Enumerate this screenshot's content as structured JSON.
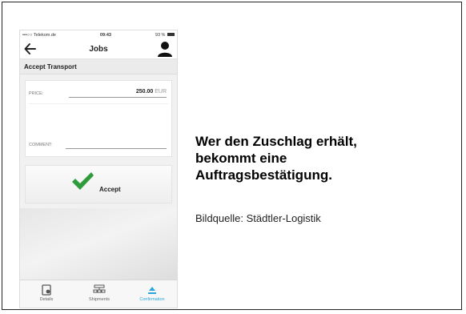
{
  "status_bar": {
    "carrier": "•••○○ Telekom.de",
    "time": "09:43",
    "battery": "93 %"
  },
  "nav": {
    "title": "Jobs",
    "back_icon": "arrow-left-icon",
    "user_icon": "user-icon"
  },
  "section_title": "Accept Transport",
  "form": {
    "price_label": "PRICE:",
    "price_value": "250.00",
    "price_currency": "EUR",
    "comment_label": "COMMENT:",
    "comment_value": ""
  },
  "accept_button": {
    "label": "Accept",
    "icon": "checkmark-icon",
    "icon_color": "#2e9c3a"
  },
  "tabs": [
    {
      "label": "Details",
      "icon": "details-icon",
      "active": false
    },
    {
      "label": "Shipments",
      "icon": "shipments-icon",
      "active": false
    },
    {
      "label": "Confirmation",
      "icon": "confirmation-icon",
      "active": true
    }
  ],
  "colors": {
    "accent": "#2aa6dd",
    "check_green": "#2e9c3a"
  },
  "caption": {
    "headline_lines": [
      "Wer den Zuschlag erhält,",
      "bekommt eine",
      "Auftragsbestätigung."
    ],
    "source": "Bildquelle: Städtler-Logistik"
  }
}
